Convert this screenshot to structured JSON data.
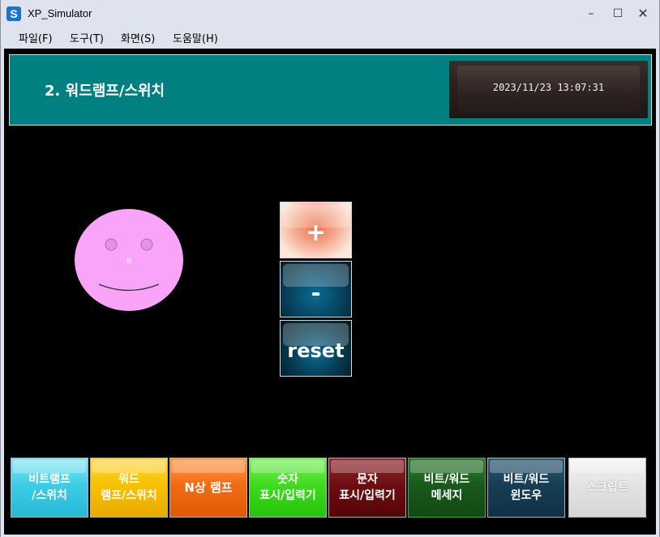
{
  "window": {
    "title": "XP_Simulator",
    "icon_letter": "S",
    "min_glyph": "–",
    "max_glyph": "☐",
    "close_glyph": "✕"
  },
  "menu": [
    "파일(F)",
    "도구(T)",
    "화면(S)",
    "도움말(H)"
  ],
  "header": {
    "title": "2. 워드램프/스위치",
    "datetime": "2023/11/23 13:07:31"
  },
  "lamp": {
    "value": "8",
    "color": "#f9a4f9"
  },
  "controls": {
    "plus": "+",
    "minus": "-",
    "reset": "reset"
  },
  "nav": [
    {
      "line1": "비트램프",
      "line2": "/스위치",
      "color": "#3ecde6"
    },
    {
      "line1": "워드",
      "line2": "램프/스위치",
      "color": "#f0b400"
    },
    {
      "line1": "N상 램프",
      "line2": "",
      "color": "#f26b14"
    },
    {
      "line1": "숫자",
      "line2": "표시/입력기",
      "color": "#3edb1e"
    },
    {
      "line1": "문자",
      "line2": "표시/입력기",
      "color": "#6b0e12"
    },
    {
      "line1": "비트/워드",
      "line2": "메세지",
      "color": "#1a5a1c"
    },
    {
      "line1": "비트/워드",
      "line2": "윈도우",
      "color": "#173e55"
    },
    {
      "line1": "스크립트",
      "line2": "",
      "color": "#e3e3e3"
    }
  ]
}
